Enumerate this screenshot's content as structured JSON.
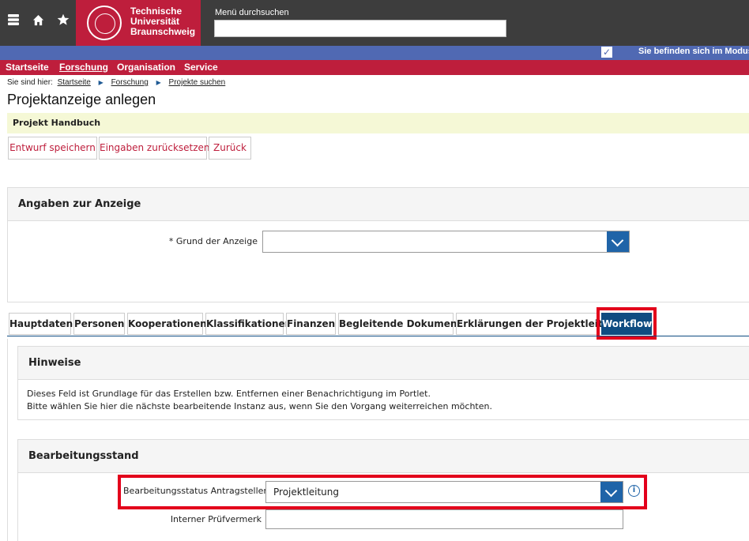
{
  "header": {
    "university_line1": "Technische",
    "university_line2": "Universität",
    "university_line3": "Braunschweig",
    "menu_search_label": "Menü durchsuchen",
    "menu_search_value": ""
  },
  "modebar": {
    "text": "Sie befinden sich im Modus"
  },
  "nav": {
    "items": [
      "Startseite",
      "Forschung",
      "Organisation",
      "Service"
    ],
    "active": "Forschung"
  },
  "breadcrumb": {
    "prefix": "Sie sind hier:",
    "items": [
      "Startseite",
      "Forschung",
      "Projekte suchen"
    ]
  },
  "page": {
    "title": "Projektanzeige anlegen",
    "context": "Projekt Handbuch"
  },
  "toolbar": {
    "save_draft": "Entwurf speichern",
    "reset": "Eingaben zurücksetzen",
    "back": "Zurück"
  },
  "announcement": {
    "heading": "Angaben zur Anzeige",
    "reason_label": "* Grund der Anzeige",
    "reason_value": ""
  },
  "tabs": {
    "items": [
      "Hauptdaten",
      "Personen",
      "Kooperationen",
      "Klassifikationen",
      "Finanzen",
      "Begleitende Dokumente",
      "Erklärungen der Projektleitung",
      "Workflow"
    ],
    "active": "Workflow"
  },
  "hints": {
    "heading": "Hinweise",
    "line1": "Dieses Feld ist Grundlage für das Erstellen bzw. Entfernen einer Benachrichtigung im Portlet.",
    "line2": "Bitte wählen Sie hier die nächste bearbeitende Instanz aus, wenn Sie den Vorgang weiterreichen möchten."
  },
  "status": {
    "heading": "Bearbeitungsstand",
    "applicant_label": "Bearbeitungsstatus Antragsteller",
    "applicant_value": "Projektleitung",
    "internal_label": "Interner Prüfvermerk",
    "internal_value": ""
  },
  "colors": {
    "brand_red": "#be1e3c",
    "mode_blue": "#5069b3",
    "action_blue": "#1f64a8",
    "highlight": "#e3001b"
  }
}
